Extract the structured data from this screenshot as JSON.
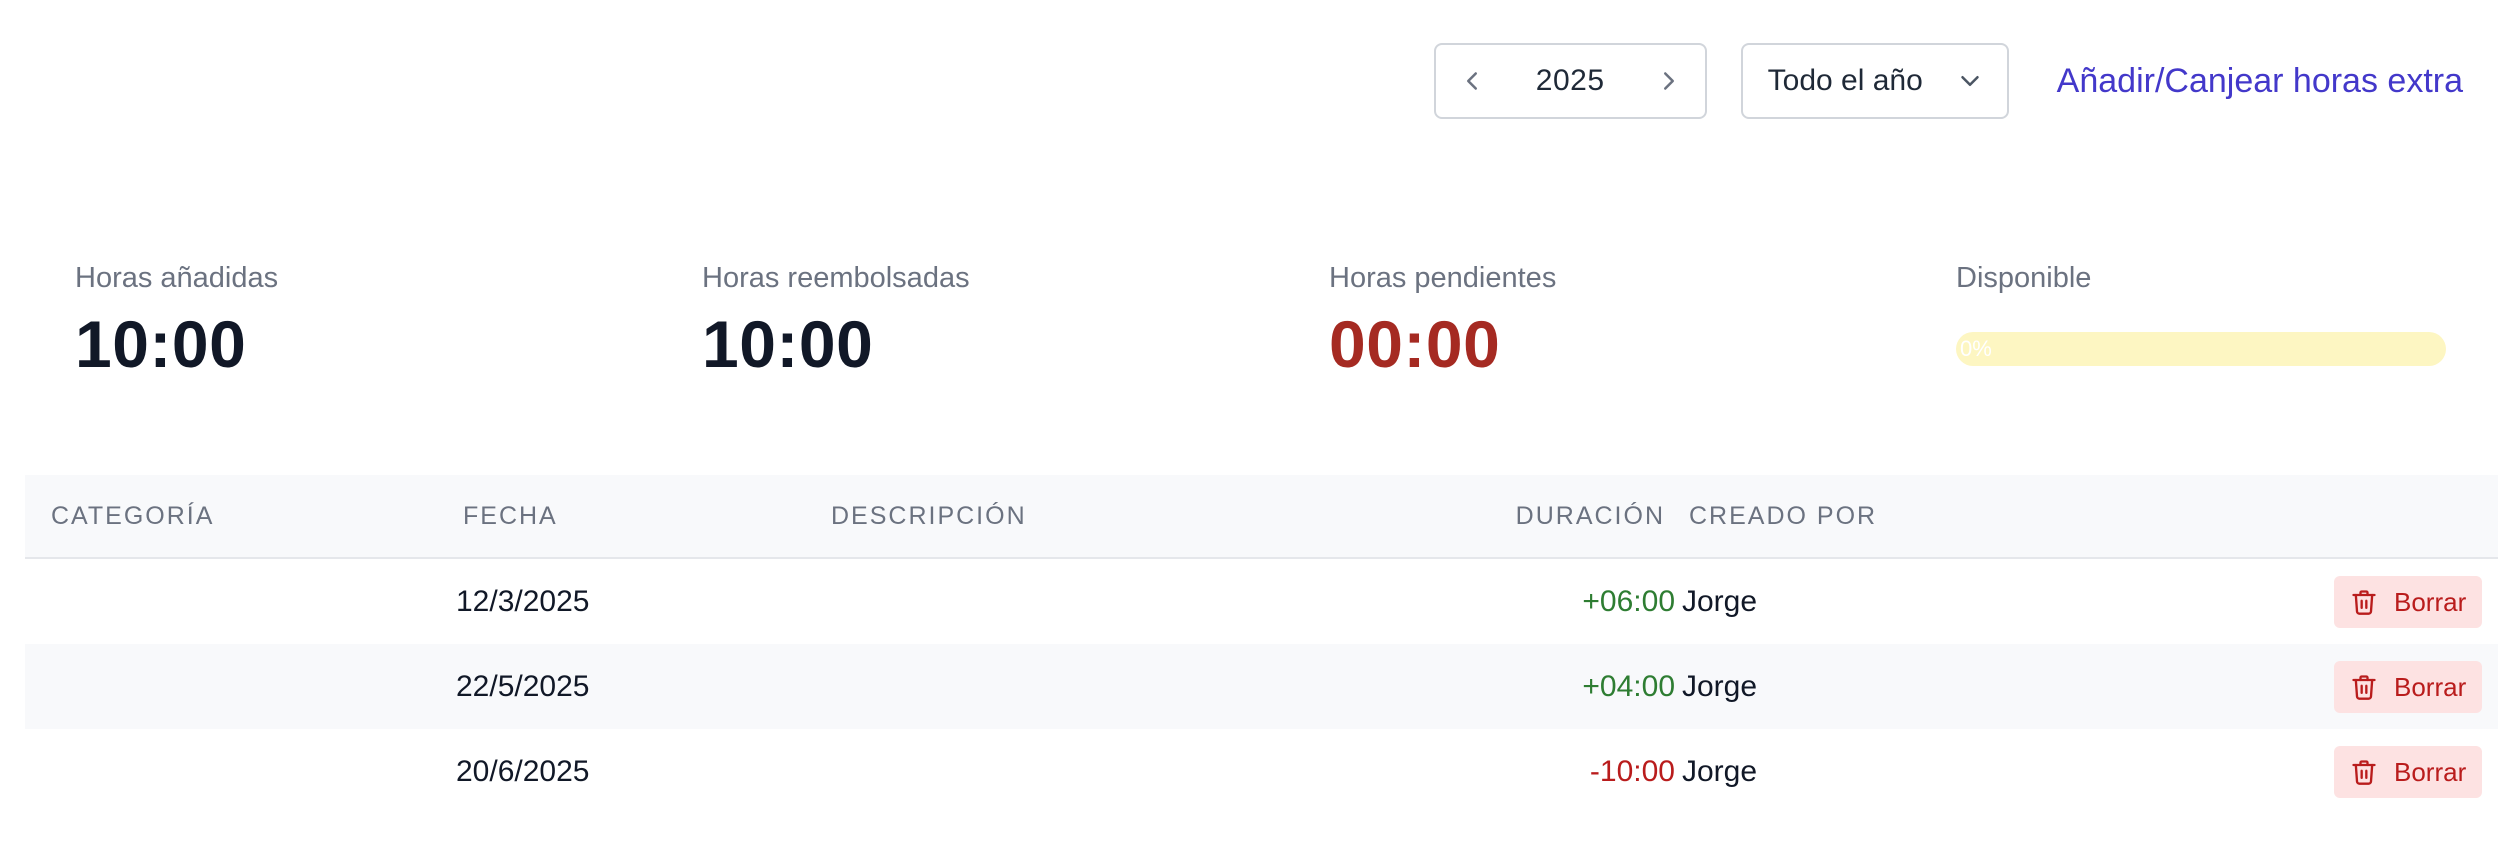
{
  "toolbar": {
    "year": "2025",
    "period": "Todo el año",
    "add_link": "Añadir/Canjear horas extra"
  },
  "stats": {
    "added": {
      "label": "Horas añadidas",
      "value": "10:00"
    },
    "reimbursed": {
      "label": "Horas reembolsadas",
      "value": "10:00"
    },
    "pending": {
      "label": "Horas pendientes",
      "value": "00:00"
    },
    "available": {
      "label": "Disponible",
      "percent_text": "0%",
      "percent": 0
    }
  },
  "table": {
    "headers": {
      "category": "CATEGORÍA",
      "date": "FECHA",
      "description": "DESCRIPCIÓN",
      "duration": "DURACIÓN",
      "created_by": "CREADO POR"
    },
    "rows": [
      {
        "category": "",
        "date": "12/3/2025",
        "description": "",
        "duration": "+06:00",
        "created_by": "Jorge",
        "delete_label": "Borrar"
      },
      {
        "category": "",
        "date": "22/5/2025",
        "description": "",
        "duration": "+04:00",
        "created_by": "Jorge",
        "delete_label": "Borrar"
      },
      {
        "category": "",
        "date": "20/6/2025",
        "description": "",
        "duration": "-10:00",
        "created_by": "Jorge",
        "delete_label": "Borrar"
      }
    ]
  },
  "colors": {
    "accent": "#4338ca",
    "positive": "#2e7d32",
    "negative": "#b91c1c",
    "pending_value": "#a52a22",
    "progress_track": "#fdf6c2",
    "delete_bg": "#fde2e2"
  },
  "icons": {
    "prev": "chevron-left-icon",
    "next": "chevron-right-icon",
    "dropdown": "chevron-down-icon",
    "delete": "trash-icon"
  }
}
